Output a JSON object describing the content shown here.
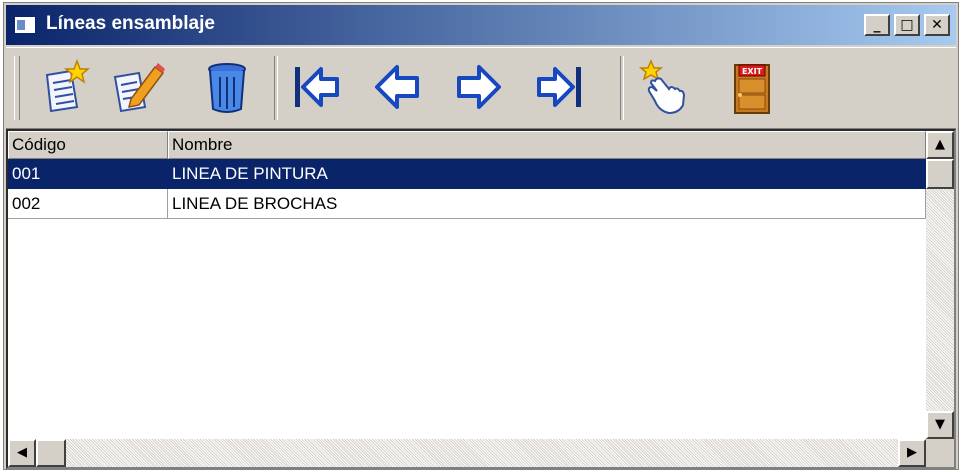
{
  "window": {
    "title": "Líneas ensamblaje",
    "controls": {
      "minimize": "_",
      "maximize": "□",
      "close": "✕"
    }
  },
  "toolbar": {
    "buttons": [
      {
        "name": "new-record",
        "icon": "new-document-icon"
      },
      {
        "name": "edit-record",
        "icon": "edit-document-icon"
      },
      {
        "name": "delete-record",
        "icon": "trash-icon"
      },
      {
        "name": "first-record",
        "icon": "first-arrow-icon"
      },
      {
        "name": "previous-record",
        "icon": "previous-arrow-icon"
      },
      {
        "name": "next-record",
        "icon": "next-arrow-icon"
      },
      {
        "name": "last-record",
        "icon": "last-arrow-icon"
      },
      {
        "name": "select-record",
        "icon": "pointing-hand-icon"
      },
      {
        "name": "exit",
        "icon": "exit-door-icon",
        "label": "EXIT"
      }
    ]
  },
  "grid": {
    "columns": [
      "Código",
      "Nombre"
    ],
    "rows": [
      {
        "codigo": "001",
        "nombre": "LINEA DE PINTURA",
        "selected": true
      },
      {
        "codigo": "002",
        "nombre": "LINEA DE BROCHAS",
        "selected": false
      }
    ]
  },
  "scrollbars": {
    "up": "▲",
    "down": "▼",
    "left": "◀",
    "right": "▶"
  },
  "colors": {
    "titlebar_start": "#0a246a",
    "titlebar_end": "#a6caf0",
    "selection": "#0a246a",
    "face": "#d4d0c8",
    "arrow_blue": "#3a6fd8",
    "door": "#c87a20",
    "exit_sign": "#d81c1c"
  }
}
